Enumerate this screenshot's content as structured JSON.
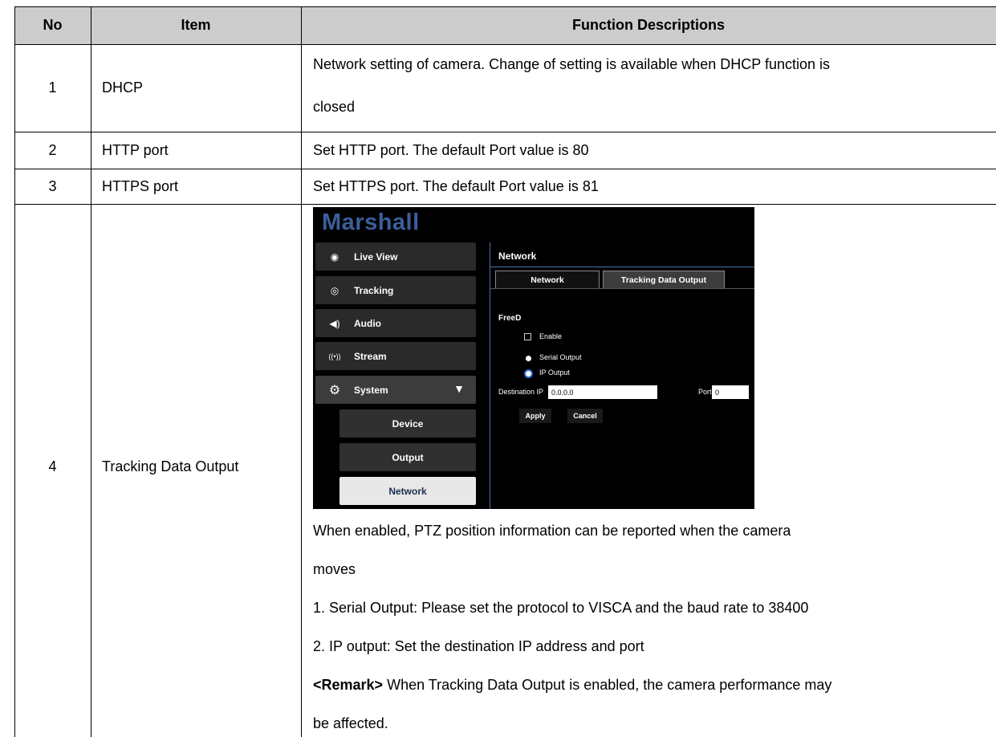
{
  "header": {
    "no": "No",
    "item": "Item",
    "desc": "Function Descriptions"
  },
  "rows": [
    {
      "no": "1",
      "item": "DHCP",
      "desc": [
        "Network setting of camera. Change of setting is available when DHCP function is",
        "closed"
      ]
    },
    {
      "no": "2",
      "item": "HTTP port",
      "desc": [
        "Set HTTP port. The default Port value is 80"
      ]
    },
    {
      "no": "3",
      "item": "HTTPS port",
      "desc": [
        "Set HTTPS port. The default Port value is 81"
      ]
    },
    {
      "no": "4",
      "item": "Tracking Data Output",
      "desc": [
        "When enabled, PTZ position information can be reported when the camera",
        "moves",
        "1. Serial Output: Please set the protocol to VISCA and the baud rate to 38400",
        "2. IP output: Set the destination IP address and port"
      ],
      "remark_label": "<Remark>",
      "remark_text": " When Tracking Data Output is enabled, the camera performance may",
      "remark_cont": "be affected."
    }
  ],
  "screenshot": {
    "logo": "Marshall",
    "sidebar": [
      {
        "label": "Live View",
        "icon": "eye-icon",
        "glyph": "◉"
      },
      {
        "label": "Tracking",
        "icon": "tracking-icon",
        "glyph": "◎"
      },
      {
        "label": "Audio",
        "icon": "speaker-icon",
        "glyph": "◀)"
      },
      {
        "label": "Stream",
        "icon": "stream-icon",
        "glyph": "((•))"
      },
      {
        "label": "System",
        "icon": "gear-icon",
        "glyph": "⚙"
      }
    ],
    "submenu": [
      "Device",
      "Output",
      "Network"
    ],
    "active_submenu": "Network",
    "panel_title": "Network",
    "tabs": [
      "Network",
      "Tracking Data Output"
    ],
    "active_tab": "Tracking Data Output",
    "section": "FreeD",
    "enable_label": "Enable",
    "serial_label": "Serial Output",
    "ip_label": "IP Output",
    "dest_ip_label": "Destination IP",
    "dest_ip_value": "0.0.0.0",
    "port_label": "Port",
    "port_value": "0",
    "apply": "Apply",
    "cancel": "Cancel",
    "colors": {
      "logo": "#3b5f9c",
      "active_sub_text": "#1b2f50",
      "radio_selected": "#2a6cd6"
    }
  }
}
